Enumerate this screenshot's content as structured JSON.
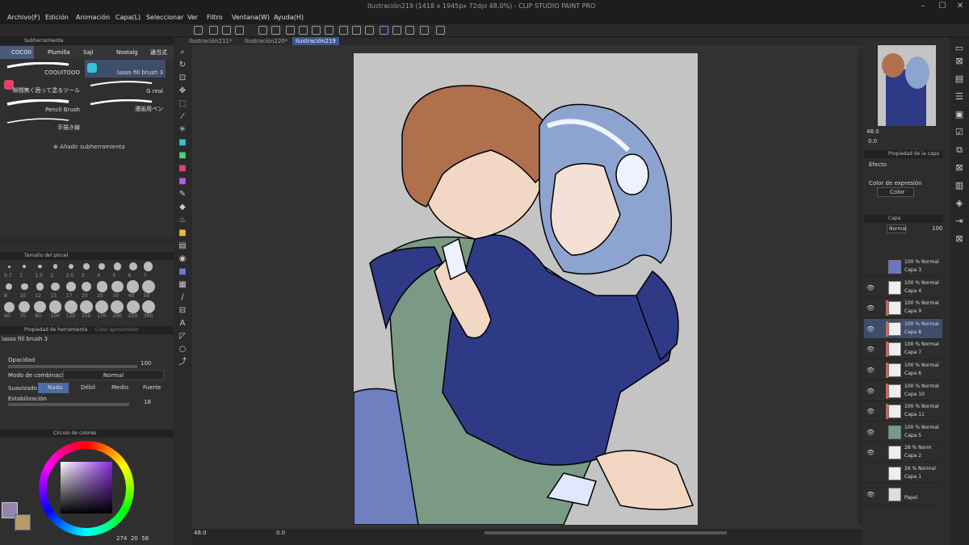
{
  "app": {
    "title": "Ilustración219 (1418 x 1945px 72dpi 48.0%) - CLIP STUDIO PAINT PRO"
  },
  "menu": [
    "Archivo(F)",
    "Edición",
    "Animación",
    "Capa(L)",
    "Seleccionar",
    "Ver",
    "Filtro",
    "Ventana(W)",
    "Ayuda(H)"
  ],
  "doc_tabs": [
    "Ilustración211*",
    "Ilustración220*",
    "Ilustración219"
  ],
  "subtool": {
    "header": "Subherramienta",
    "tabs": [
      "COCOII",
      "Plumilla",
      "Saji",
      "Nostalg",
      "通当式"
    ],
    "brushes": [
      {
        "name": "COQUITOOO"
      },
      {
        "name": "lasso fill brush 3"
      },
      {
        "name": "隙間無く囲って塗るツール"
      },
      {
        "name": "G real"
      },
      {
        "name": "Pencil Brush"
      },
      {
        "name": "漫画用ペン"
      },
      {
        "name": "手描き線"
      }
    ],
    "add_label": "Añadir subherramienta"
  },
  "brush_size": {
    "header": "Tamaño del pincel",
    "row1": [
      "0.7",
      "1",
      "1.5",
      "2",
      "2.5",
      "3",
      "4",
      "5",
      "6",
      "7"
    ],
    "row2": [
      "8",
      "10",
      "12",
      "15",
      "17",
      "20",
      "25",
      "30",
      "40",
      "50"
    ],
    "row3": [
      "60",
      "70",
      "80",
      "100",
      "120",
      "150",
      "170",
      "200",
      "250",
      "300"
    ]
  },
  "tool_property": {
    "tab1": "Propiedad de herramienta",
    "tab2": "Color aproximado",
    "brush_name": "lasso fill brush 3",
    "opacity_label": "Opacidad",
    "opacity_value": "100",
    "blend_label": "Modo de combinación",
    "blend_value": "Normal",
    "smooth_label": "Suavizado",
    "smooth_options": [
      "Nada",
      "Débil",
      "Medio",
      "Fuerte"
    ],
    "stab_label": "Estabilización",
    "stab_value": "18"
  },
  "color_wheel": {
    "header": "Círculo de colores",
    "readout": [
      "274",
      "20",
      "58"
    ],
    "main_color": "#9384b0",
    "sub_color": "#b49a6c"
  },
  "navigator": {
    "zoom": "48.0",
    "angle": "0.0"
  },
  "layer_property": {
    "header": "Propiedad de la capa",
    "effect_label": "Efecto",
    "expression_label": "Color de expresión",
    "expression_value": "Color"
  },
  "layers_panel": {
    "header": "Capa",
    "blend": "Normal",
    "opacity": "100",
    "layers": [
      {
        "op": "100 % Normal",
        "name": "Capa 3"
      },
      {
        "op": "100 % Normal",
        "name": "Capa 4"
      },
      {
        "op": "100 % Normal",
        "name": "Capa 9"
      },
      {
        "op": "100 % Normal",
        "name": "Capa 8"
      },
      {
        "op": "100 % Normal",
        "name": "Capa 7"
      },
      {
        "op": "100 % Normal",
        "name": "Capa 6"
      },
      {
        "op": "100 % Normal",
        "name": "Capa 10"
      },
      {
        "op": "100 % Normal",
        "name": "Capa 11"
      },
      {
        "op": "100 % Normal",
        "name": "Capa 5"
      },
      {
        "op": "28 % Norm",
        "name": "Capa 2"
      },
      {
        "op": "26 % Normal",
        "name": "Capa 1"
      },
      {
        "op": "",
        "name": "Papel"
      }
    ]
  },
  "status": {
    "zoom": "48.0",
    "angle": "0.0"
  },
  "colors": {
    "accent": "#3b5a8f",
    "canvas_bg": "#c4c4c4",
    "navy": "#2e3a86",
    "green": "#7a9a86",
    "hair_brown": "#b0704e",
    "hair_blue": "#8ea4d0"
  }
}
